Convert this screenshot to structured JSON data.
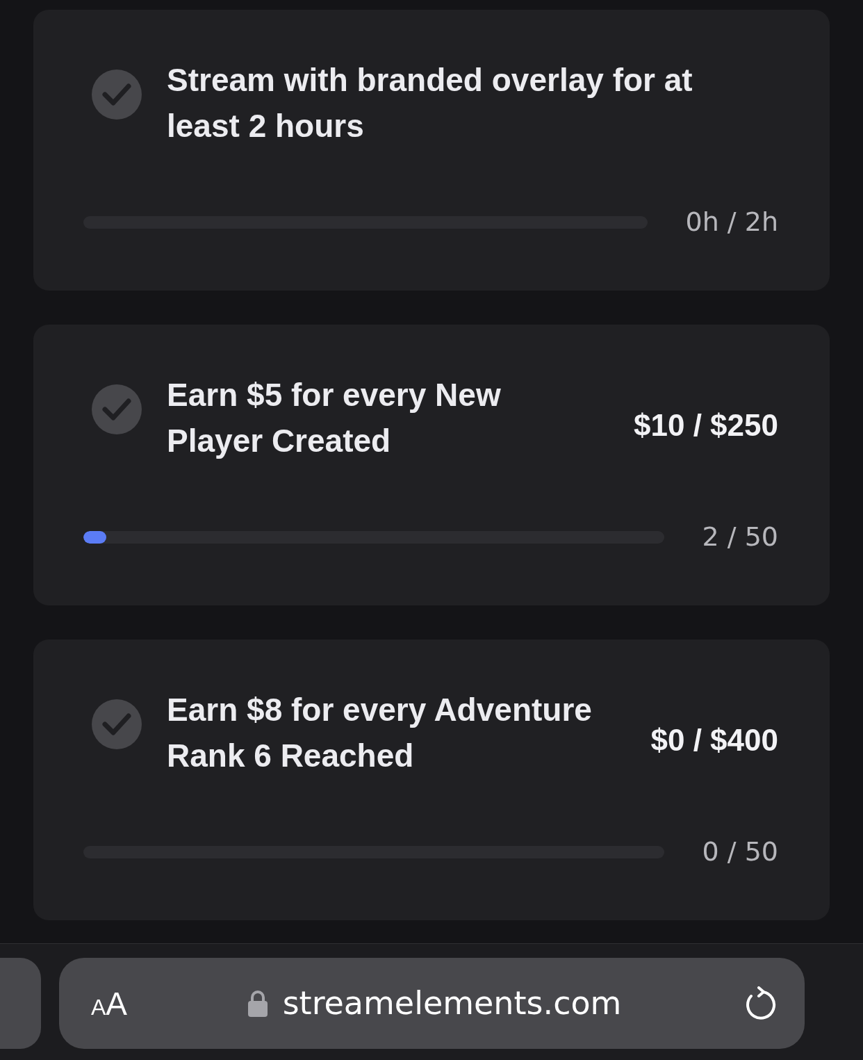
{
  "tasks": [
    {
      "title": "Stream with branded overlay for at least 2 hours",
      "completed": false,
      "progress": {
        "reading": "0h / 2h"
      }
    },
    {
      "title": "Earn $5 for every New Player Created",
      "completed": false,
      "reward": "$10 / $250",
      "progress": {
        "level": 0.04,
        "reading": "2 / 50"
      }
    },
    {
      "title": "Earn $8 for every Adventure Rank 6 Reached",
      "completed": false,
      "reward": "$0 / $400",
      "progress": {
        "reading": "0 / 50"
      }
    }
  ],
  "browser_bar": {
    "text_size_button": "AA",
    "secure": true,
    "url": "streamelements.com"
  }
}
